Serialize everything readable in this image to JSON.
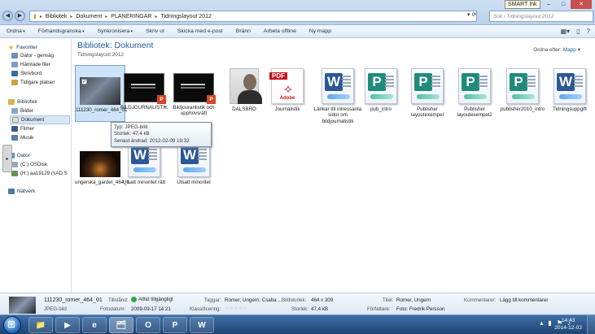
{
  "window": {
    "breadcrumb": [
      "Bibliotek",
      "Dokument",
      "PLANERINGAR",
      "Tidningslayout 2012"
    ],
    "search_placeholder": "Sök i Tidningslayout 2012",
    "smart_ink": "SMART Ink",
    "minimize": "–",
    "maximize": "□",
    "close": "✕"
  },
  "toolbar": {
    "organize": "Ordna",
    "preview": "Förhandsgranska",
    "sync": "Synkronisera",
    "print": "Skriv ut",
    "email": "Skicka med e-post",
    "burn": "Bränn",
    "offline": "Arbeta offline",
    "new_folder": "Ny mapp"
  },
  "sidebar": {
    "favorites": "Favoriter",
    "fav_items": [
      "Dator - genväg",
      "Hämtade filer",
      "Skrivbord",
      "Tidigare platser"
    ],
    "libraries": "Bibliotek",
    "lib_items": [
      "Bilder",
      "Dokument",
      "Filmer",
      "Musik"
    ],
    "computer": "Dator",
    "comp_items": [
      "(C:) OSDisk",
      "(H:) aa19129 (\\\\AD.S"
    ],
    "network": "Nätverk"
  },
  "main": {
    "title": "Bibliotek: Dokument",
    "subtitle": "Tidningslayout 2012",
    "sort_label": "Ordna efter:",
    "sort_value": "Mapp"
  },
  "files": [
    {
      "name": "111230_romer_464_01",
      "type": "photo"
    },
    {
      "name": "BILDJOURNALISTIK",
      "type": "ppt"
    },
    {
      "name": "Bildjouranlistik och upphovsrätt",
      "type": "ppt"
    },
    {
      "name": "DALSBRO",
      "type": "portrait"
    },
    {
      "name": "Journalistik",
      "type": "pdf"
    },
    {
      "name": "Länkar till intressanta sidor om bildjournalistik",
      "type": "word"
    },
    {
      "name": "pub_intro",
      "type": "pub"
    },
    {
      "name": "Publisher layoutexempel",
      "type": "pub"
    },
    {
      "name": "Publisher layoutexempel2",
      "type": "pub"
    },
    {
      "name": "publisher2010_intro",
      "type": "pub"
    },
    {
      "name": "Tidningsuppgift",
      "type": "word"
    },
    {
      "name": "ungerska_gardet_464_1",
      "type": "concert"
    },
    {
      "name": "Utsatt minoritet rätt",
      "type": "word"
    },
    {
      "name": "Utsatt minoritet",
      "type": "word"
    }
  ],
  "tooltip": {
    "type": "Typ: JPEG-bild",
    "size": "Storlek: 47,4 kB",
    "modified": "Senast ändrad: 2012-02-09 19:32"
  },
  "details": {
    "name": "111230_romer_464_01",
    "kind": "JPEG-bild",
    "availability_label": "Tillstånd:",
    "availability_value": "Alltid tillgängligt",
    "date_label": "Fotodatum:",
    "date_value": "2009-09-17 14:21",
    "tags_label": "Taggar:",
    "tags_value": "Romer; Ungern; Csaba ...",
    "rating_label": "Klassificering:",
    "rating_value": "☆☆☆☆☆",
    "dims_label": "Bildstorlek:",
    "dims_value": "464 x 309",
    "size_label": "Storlek:",
    "size_value": "47,4 kB",
    "title_label": "Titel:",
    "title_value": "Romer, Ungern",
    "author_label": "Författare:",
    "author_value": "Foto: Fredrik Persson",
    "comments_label": "Kommentarer:",
    "comments_value": "Lägg till kommentarer"
  },
  "taskbar": {
    "time": "14:43",
    "date": "2014-12-02",
    "buttons": [
      "📁",
      "▶",
      "e",
      "🗂",
      "O",
      "P",
      "W"
    ]
  }
}
